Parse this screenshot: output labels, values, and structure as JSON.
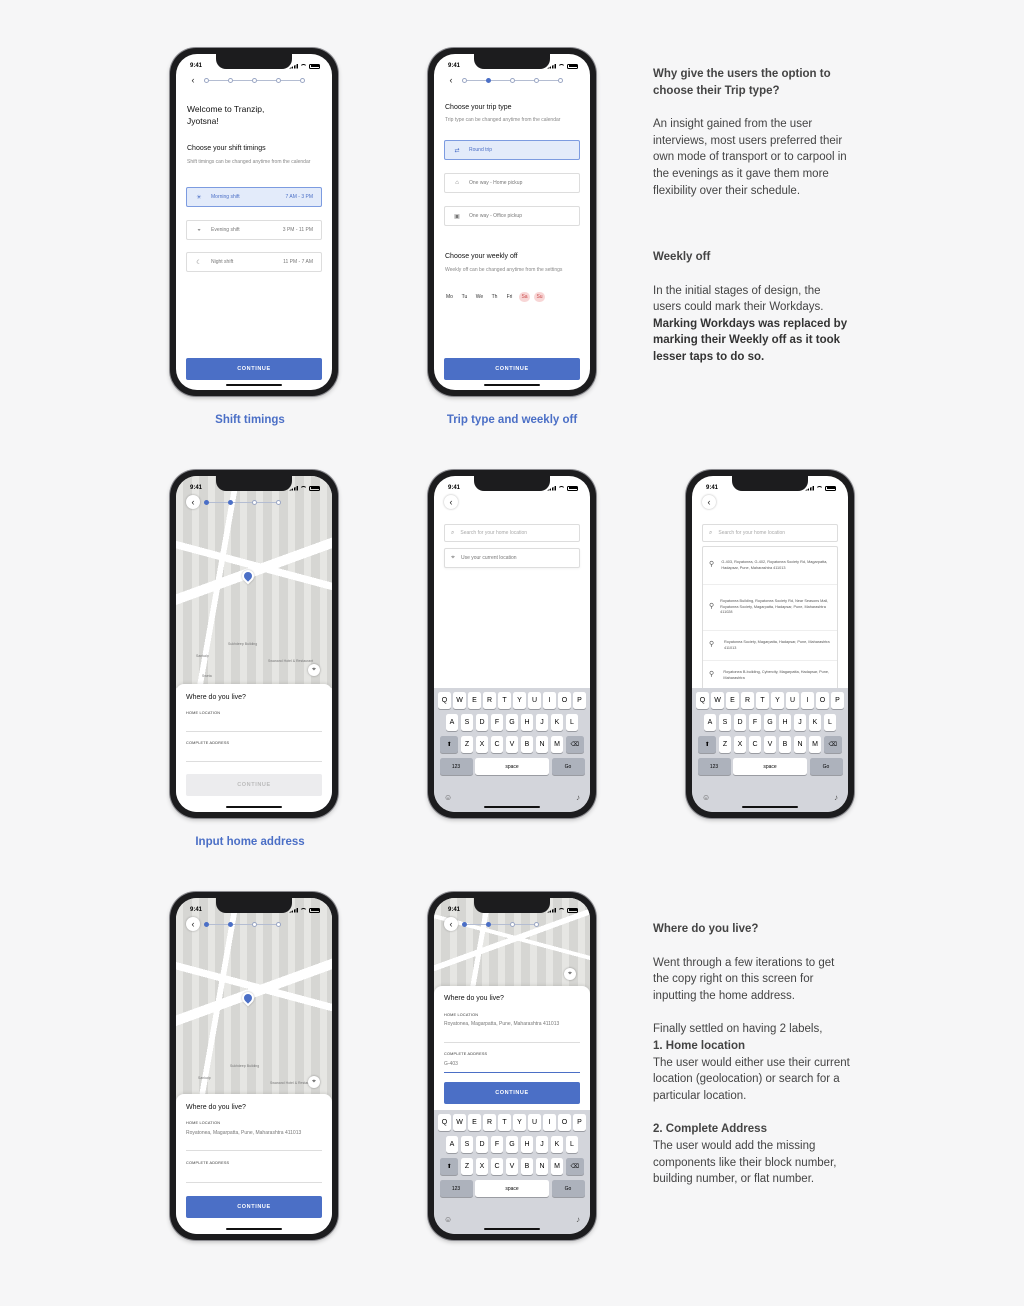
{
  "status_time": "9:41",
  "screen1": {
    "title": "Welcome to Tranzip, Jyotsna!",
    "section_title": "Choose your shift timings",
    "section_sub": "Shift timings can be changed anytime from the calendar",
    "shifts": [
      {
        "icon": "sun-icon",
        "glyph": "☀",
        "label": "Morning shift",
        "time": "7 AM - 3 PM",
        "selected": true
      },
      {
        "icon": "sunset-icon",
        "glyph": "◒",
        "label": "Evening shift",
        "time": "3 PM - 11 PM",
        "selected": false
      },
      {
        "icon": "moon-icon",
        "glyph": "☾",
        "label": "Night shift",
        "time": "11 PM - 7 AM",
        "selected": false
      }
    ],
    "cta": "CONTINUE"
  },
  "screen2": {
    "title": "Choose your trip type",
    "sub": "Trip type can be changed anytime from the calendar",
    "trips": [
      {
        "glyph": "⇄",
        "label": "Round trip",
        "selected": true
      },
      {
        "glyph": "⌂",
        "label": "One way - Home pickup",
        "selected": false
      },
      {
        "glyph": "▣",
        "label": "One way - Office pickup",
        "selected": false
      }
    ],
    "weekly_title": "Choose your weekly off",
    "weekly_sub": "Weekly off can be changed anytime from the settings",
    "days": [
      {
        "label": "Mo",
        "off": false
      },
      {
        "label": "Tu",
        "off": false
      },
      {
        "label": "We",
        "off": false
      },
      {
        "label": "Th",
        "off": false
      },
      {
        "label": "Fri",
        "off": false
      },
      {
        "label": "Sa",
        "off": true
      },
      {
        "label": "Su",
        "off": true
      }
    ],
    "cta": "CONTINUE"
  },
  "screen3": {
    "map_labels": [
      "Sankalp",
      "Sukhdeep Building",
      "Swanand Hotel & Restaurant",
      "Sweta",
      "Sankalp"
    ],
    "title": "Where do you live?",
    "home_label": "HOME LOCATION",
    "complete_label": "COMPLETE ADDRESS",
    "cta": "CONTINUE"
  },
  "screen4": {
    "search_placeholder": "Search for your home location",
    "current_location": "Use your current location"
  },
  "screen5": {
    "search_placeholder": "Search for your home location",
    "results": [
      "G-403, Royatonea, G-402, Royatonea Society Rd, Magarpatta, Hadapsar, Pune, Maharashtra 411013",
      "Royatonea Building, Royatonea Society Rd, Near Seasons Mall, Royatonea Society, Magarpatta, Hadapsar, Pune, Maharashtra 411028",
      "Royatonea Society, Magarpatta, Hadapsar, Pune, Maharashtra 411013",
      "Royatonea B-building, Cybercity, Magarpatta, Hadapsar, Pune, Maharashtra"
    ]
  },
  "screen6": {
    "title": "Where do you live?",
    "home_label": "HOME LOCATION",
    "home_value": "Royatonea, Magarpatta, Pune, Maharashtra 411013",
    "complete_label": "COMPLETE ADDRESS",
    "cta": "CONTINUE"
  },
  "screen7": {
    "title": "Where do you live?",
    "home_label": "HOME LOCATION",
    "home_value": "Royatonea, Magarpatta, Pune, Maharashtra 411013",
    "complete_label": "COMPLETE ADDRESS",
    "complete_value": "G-403",
    "cta": "CONTINUE"
  },
  "keyboard": {
    "row1": [
      "Q",
      "W",
      "E",
      "R",
      "T",
      "Y",
      "U",
      "I",
      "O",
      "P"
    ],
    "row2": [
      "A",
      "S",
      "D",
      "F",
      "G",
      "H",
      "J",
      "K",
      "L"
    ],
    "row3": [
      "Z",
      "X",
      "C",
      "V",
      "B",
      "N",
      "M"
    ],
    "shift": "⬆",
    "backspace": "⌫",
    "numbers": "123",
    "space": "space",
    "go": "Go",
    "emoji": "☺",
    "mic": "🎙"
  },
  "captions": {
    "shift": "Shift timings",
    "trip": "Trip type and weekly off",
    "home": "Input home address"
  },
  "notes": {
    "trip_heading": "Why give the users the option to choose their Trip type?",
    "trip_body": "An insight gained from the user interviews, most users preferred their own mode of transport or to carpool in the evenings as it gave them more flexibility over their schedule.",
    "weekly_heading": "Weekly off",
    "weekly_body1": "In the initial stages of design, the users could mark their Workdays.",
    "weekly_body2": "Marking Workdays was replaced by marking their Weekly off as it took lesser taps to do so.",
    "live_heading": "Where do you live?",
    "live_body": "Went through a few iterations to get the copy right on this screen for inputting the home address.",
    "live_settled": "Finally settled on having 2 labels,",
    "label1_title": "1. Home location",
    "label1_body": "The user would either use their current location (geolocation) or search for a particular location.",
    "label2_title": "2. Complete Address",
    "label2_body": "The user would add the missing components like their block number, building number, or flat number."
  }
}
